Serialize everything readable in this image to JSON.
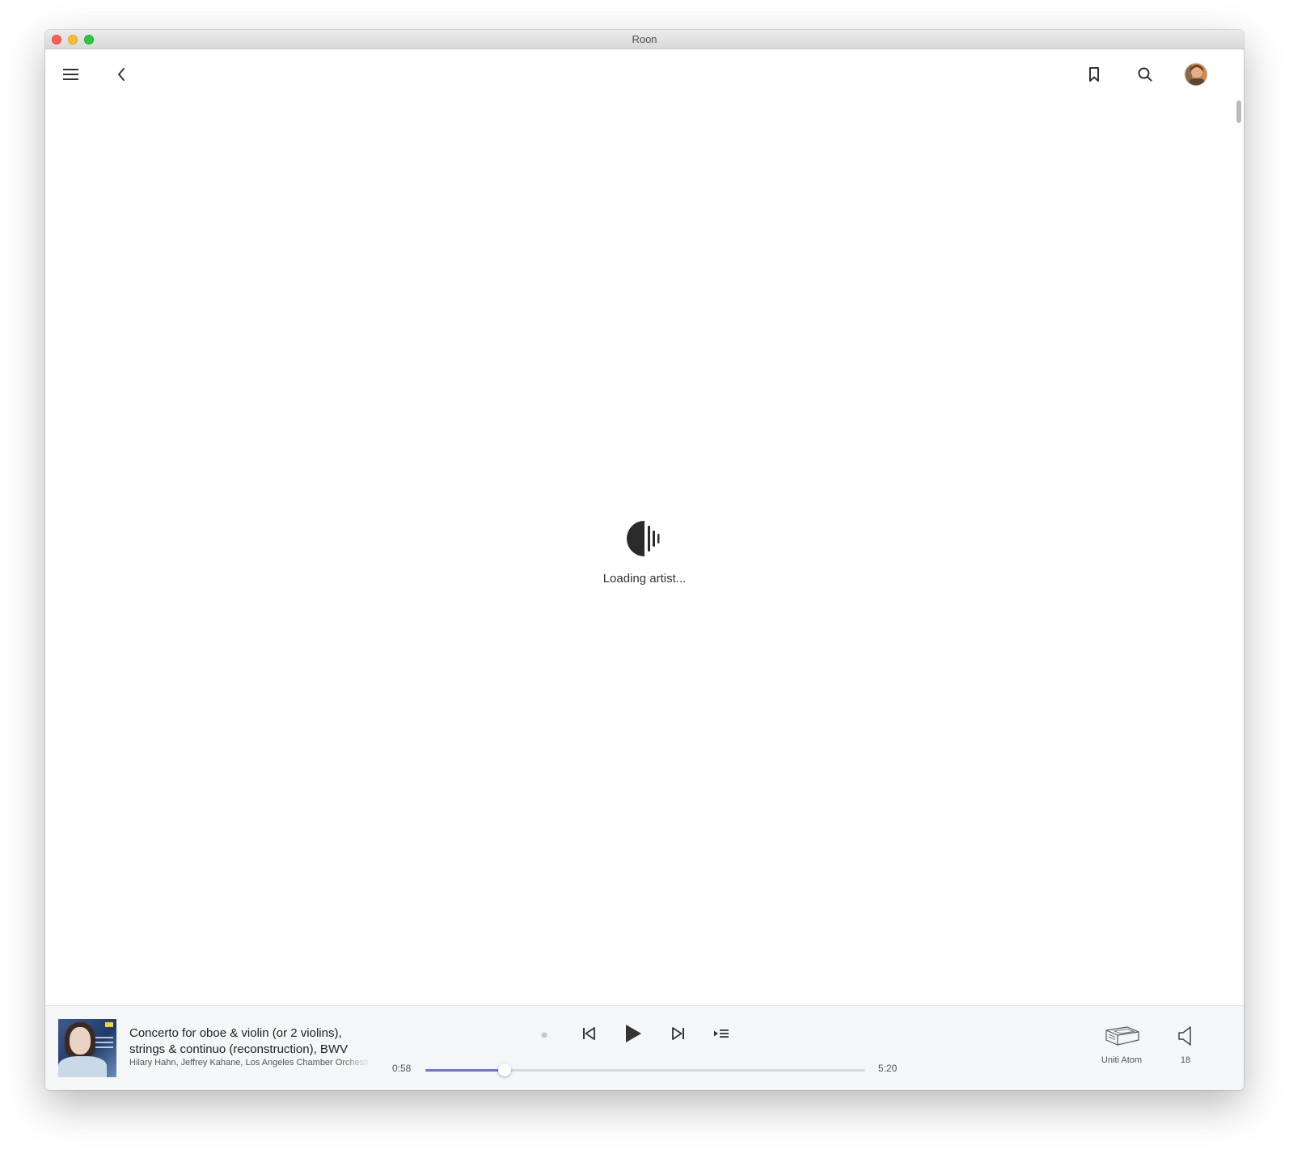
{
  "window": {
    "title": "Roon"
  },
  "toolbar": {
    "menu_icon": "hamburger-menu-icon",
    "back_icon": "chevron-left-icon",
    "bookmark_icon": "bookmark-icon",
    "search_icon": "search-icon",
    "avatar_icon": "profile-avatar"
  },
  "main": {
    "loading_text": "Loading artist..."
  },
  "now_playing": {
    "title": "Concerto for oboe & violin (or 2 violins), strings & continuo (reconstruction), BWV",
    "artists": "Hilary Hahn, Jeffrey Kahane, Los Angeles Chamber Orchestra",
    "elapsed": "0:58",
    "duration": "5:20",
    "progress_fraction": 0.181,
    "zone_name": "Uniti Atom",
    "volume": "18",
    "colors": {
      "accent": "#6e73e3",
      "background": "#f5f6f8"
    }
  }
}
